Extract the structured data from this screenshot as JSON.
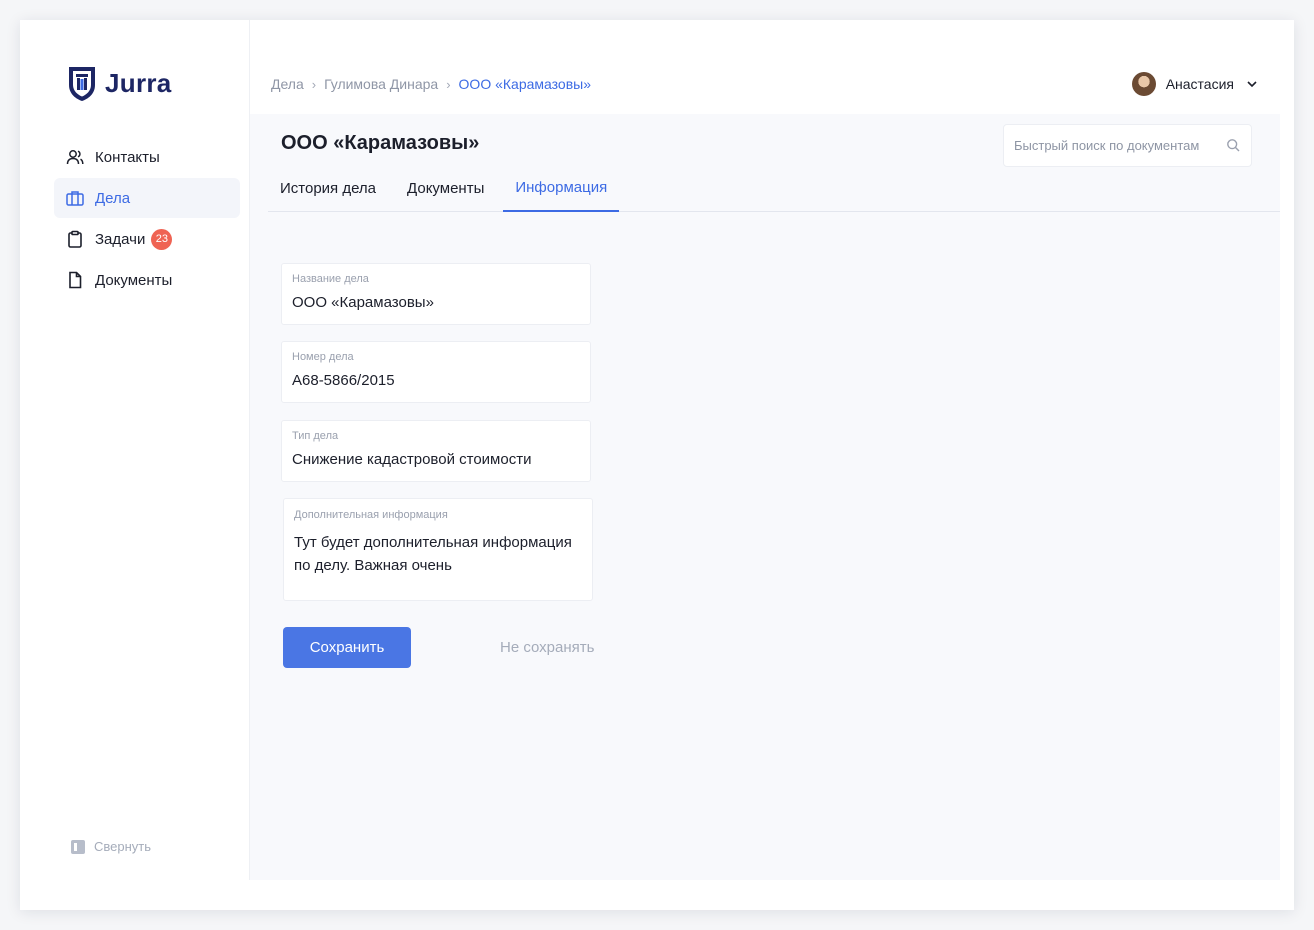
{
  "app": {
    "name": "Jurra"
  },
  "sidebar": {
    "items": [
      {
        "label": "Контакты"
      },
      {
        "label": "Дела"
      },
      {
        "label": "Задачи",
        "badge": "23"
      },
      {
        "label": "Документы"
      }
    ],
    "collapse_label": "Свернуть"
  },
  "breadcrumb": [
    "Дела",
    "Гулимова Динара",
    "ООО «Карамазовы»"
  ],
  "user": {
    "name": "Анастасия"
  },
  "page": {
    "title": "ООО «Карамазовы»"
  },
  "search": {
    "placeholder": "Быстрый поиск по документам",
    "value": ""
  },
  "tabs": [
    {
      "label": "История дела"
    },
    {
      "label": "Документы"
    },
    {
      "label": "Информация",
      "active": true
    }
  ],
  "form": {
    "name": {
      "label": "Название дела",
      "value": "ООО «Карамазовы»"
    },
    "number": {
      "label": "Номер дела",
      "value": "А68-5866/2015"
    },
    "type": {
      "label": "Тип дела",
      "value": "Снижение кадастровой стоимости"
    },
    "extra": {
      "label": "Дополнительная информация",
      "value": "Тут будет дополнительная информация\nпо делу. Важная очень"
    }
  },
  "actions": {
    "save_label": "Сохранить",
    "cancel_label": "Не сохранять"
  },
  "colors": {
    "accent": "#4a76e4",
    "brand": "#1d2664",
    "badge": "#ef6353"
  }
}
